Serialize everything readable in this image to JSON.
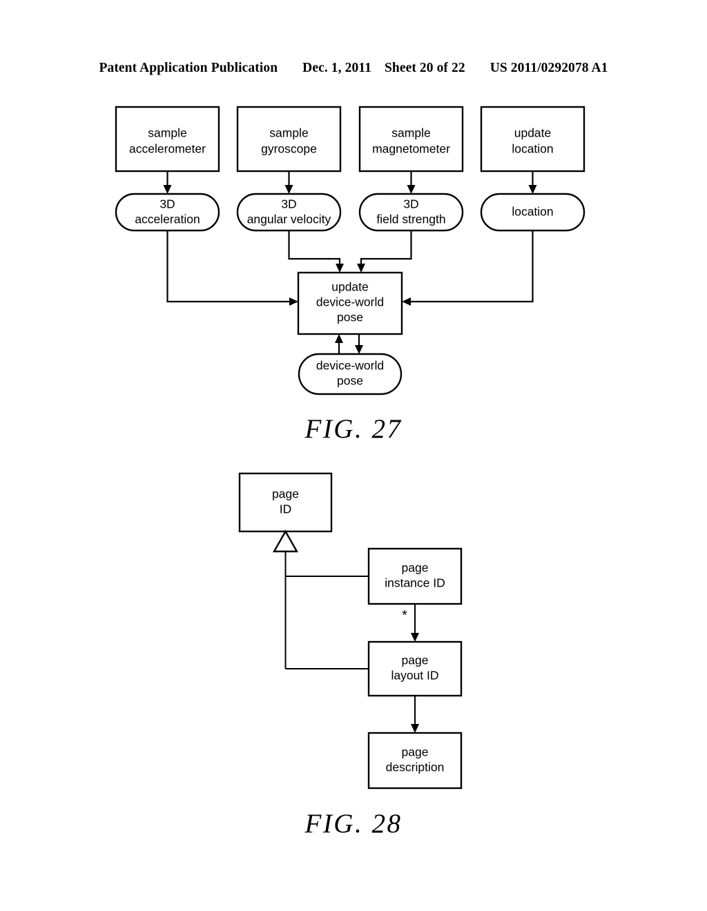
{
  "header": {
    "publication": "Patent Application Publication",
    "date": "Dec. 1, 2011",
    "sheet": "Sheet 20 of 22",
    "patent_number": "US 2011/0292078 A1"
  },
  "figures": [
    {
      "id": "fig-27",
      "caption": "FIG. 27",
      "type": "dataflow-diagram",
      "nodes": [
        {
          "id": "sample-accelerometer",
          "shape": "rect",
          "lines": [
            "sample",
            "accelerometer"
          ]
        },
        {
          "id": "sample-gyroscope",
          "shape": "rect",
          "lines": [
            "sample",
            "gyroscope"
          ]
        },
        {
          "id": "sample-magnetometer",
          "shape": "rect",
          "lines": [
            "sample",
            "magnetometer"
          ]
        },
        {
          "id": "update-location",
          "shape": "rect",
          "lines": [
            "update",
            "location"
          ]
        },
        {
          "id": "3d-acceleration",
          "shape": "round",
          "lines": [
            "3D",
            "acceleration"
          ]
        },
        {
          "id": "3d-angular-velocity",
          "shape": "round",
          "lines": [
            "3D",
            "angular velocity"
          ]
        },
        {
          "id": "3d-field-strength",
          "shape": "round",
          "lines": [
            "3D",
            "field strength"
          ]
        },
        {
          "id": "location",
          "shape": "round",
          "lines": [
            "location"
          ]
        },
        {
          "id": "update-device-world-pose",
          "shape": "rect",
          "lines": [
            "update",
            "device-world",
            "pose"
          ]
        },
        {
          "id": "device-world-pose",
          "shape": "round",
          "lines": [
            "device-world",
            "pose"
          ]
        }
      ],
      "edges": [
        {
          "from": "sample-accelerometer",
          "to": "3d-acceleration",
          "arrow": "single"
        },
        {
          "from": "sample-gyroscope",
          "to": "3d-angular-velocity",
          "arrow": "single"
        },
        {
          "from": "sample-magnetometer",
          "to": "3d-field-strength",
          "arrow": "single"
        },
        {
          "from": "update-location",
          "to": "location",
          "arrow": "single"
        },
        {
          "from": "3d-acceleration",
          "to": "update-device-world-pose",
          "arrow": "single"
        },
        {
          "from": "3d-angular-velocity",
          "to": "update-device-world-pose",
          "arrow": "single"
        },
        {
          "from": "3d-field-strength",
          "to": "update-device-world-pose",
          "arrow": "single"
        },
        {
          "from": "location",
          "to": "update-device-world-pose",
          "arrow": "single"
        },
        {
          "from": "update-device-world-pose",
          "to": "device-world-pose",
          "arrow": "single"
        },
        {
          "from": "device-world-pose",
          "to": "update-device-world-pose",
          "arrow": "single"
        }
      ]
    },
    {
      "id": "fig-28",
      "caption": "FIG. 28",
      "type": "class-diagram",
      "nodes": [
        {
          "id": "page-id",
          "shape": "rect",
          "lines": [
            "page",
            "ID"
          ]
        },
        {
          "id": "page-instance-id",
          "shape": "rect",
          "lines": [
            "page",
            "instance ID"
          ]
        },
        {
          "id": "page-layout-id",
          "shape": "rect",
          "lines": [
            "page",
            "layout ID"
          ]
        },
        {
          "id": "page-description",
          "shape": "rect",
          "lines": [
            "page",
            "description"
          ]
        }
      ],
      "edges": [
        {
          "from": "page-instance-id",
          "to": "page-id",
          "arrow": "generalization"
        },
        {
          "from": "page-layout-id",
          "to": "page-id",
          "arrow": "generalization"
        },
        {
          "from": "page-instance-id",
          "to": "page-layout-id",
          "arrow": "single",
          "label": "*"
        },
        {
          "from": "page-layout-id",
          "to": "page-description",
          "arrow": "single"
        }
      ],
      "multiplicity_labels": [
        "*"
      ]
    }
  ],
  "colors": {
    "ink": "#000000",
    "paper": "#ffffff"
  }
}
